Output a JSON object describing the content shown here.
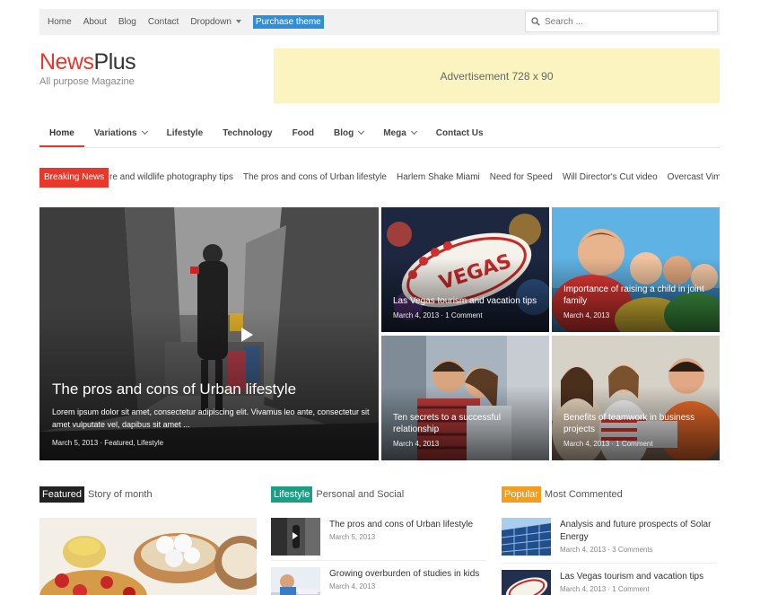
{
  "topnav": {
    "items": [
      "Home",
      "About",
      "Blog",
      "Contact",
      "Dropdown"
    ],
    "purchase_label": "Purchase theme"
  },
  "search": {
    "placeholder": "Search ..."
  },
  "logo": {
    "brand_part1": "News",
    "brand_part2": "Plus",
    "tagline": "All purpose Magazine"
  },
  "ad": {
    "label": "Advertisement 728 x 90"
  },
  "mainnav": {
    "items": [
      "Home",
      "Variations",
      "Lifestyle",
      "Technology",
      "Food",
      "Blog",
      "Mega",
      "Contact Us"
    ],
    "active": "Home"
  },
  "breaking": {
    "label": "Breaking News",
    "items": [
      "re and wildlife photography tips",
      "The pros and cons of Urban lifestyle",
      "Harlem Shake Miami",
      "Need for Speed",
      "Will Director's Cut video",
      "Overcast Vimeo"
    ]
  },
  "featured_grid": {
    "big": {
      "title": "The pros and cons of Urban lifestyle",
      "excerpt": "Lorem ipsum dolor sit amet, consectetur adipiscing elit. Vivamus leo ante, consectetur sit amet vulputate vel, dapibus sit amet ...",
      "meta": "March 5, 2013 · Featured, Lifestyle"
    },
    "tiles": [
      {
        "title": "Las Vegas tourism and vacation tips",
        "meta": "March 4, 2013 · 1 Comment"
      },
      {
        "title": "Importance of raising a child in joint family",
        "meta": "March 4, 2013"
      },
      {
        "title": "Ten secrets to a successful relationship",
        "meta": "March 4, 2013"
      },
      {
        "title": "Benefits of teamwork in business projects",
        "meta": "March 4, 2013 · 1 Comment"
      }
    ]
  },
  "sections": {
    "featured": {
      "badge": "Featured",
      "subtitle": "Story of month",
      "color": "#222222"
    },
    "lifestyle": {
      "badge": "Lifestyle",
      "subtitle": "Personal and Social",
      "color": "#1a9e86",
      "posts": [
        {
          "title": "The pros and cons of Urban lifestyle",
          "meta": "March 5, 2013"
        },
        {
          "title": "Growing overburden of studies in kids",
          "meta": "March 4, 2013"
        }
      ]
    },
    "popular": {
      "badge": "Popular",
      "subtitle": "Most Commented",
      "color": "#f39c1f",
      "posts": [
        {
          "title": "Analysis and future prospects of Solar Energy",
          "meta": "March 4, 2013 · 3 Comments"
        },
        {
          "title": "Las Vegas tourism and vacation tips",
          "meta": "March 4, 2013 · 1 Comment"
        }
      ]
    }
  },
  "colors": {
    "accent": "#e8382b",
    "purchase": "#2e8ed8",
    "ad_bg": "#fbf4c0"
  }
}
